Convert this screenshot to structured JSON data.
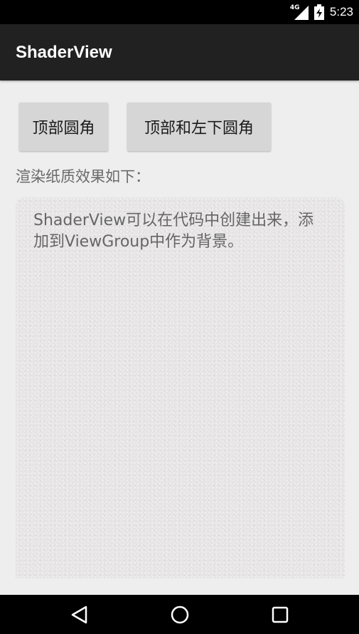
{
  "status_bar": {
    "network_type": "4G",
    "time": "5:23",
    "icons": [
      "signal-icon",
      "battery-charging-icon"
    ]
  },
  "action_bar": {
    "title": "ShaderView"
  },
  "buttons": {
    "top_rounded_label": "顶部圆角",
    "top_and_bottom_left_rounded_label": "顶部和左下圆角"
  },
  "content": {
    "paper_effect_label": "渲染纸质效果如下：",
    "paper_text": "ShaderView可以在代码中创建出来，添加到ViewGroup中作为背景。"
  },
  "nav_bar": {
    "icons": [
      "back-icon",
      "home-icon",
      "recents-icon"
    ]
  },
  "colors": {
    "status_bar": "#000000",
    "action_bar": "#212121",
    "background": "#eeeeee",
    "button": "#d6d6d6",
    "paper": "#e7e5e5"
  }
}
